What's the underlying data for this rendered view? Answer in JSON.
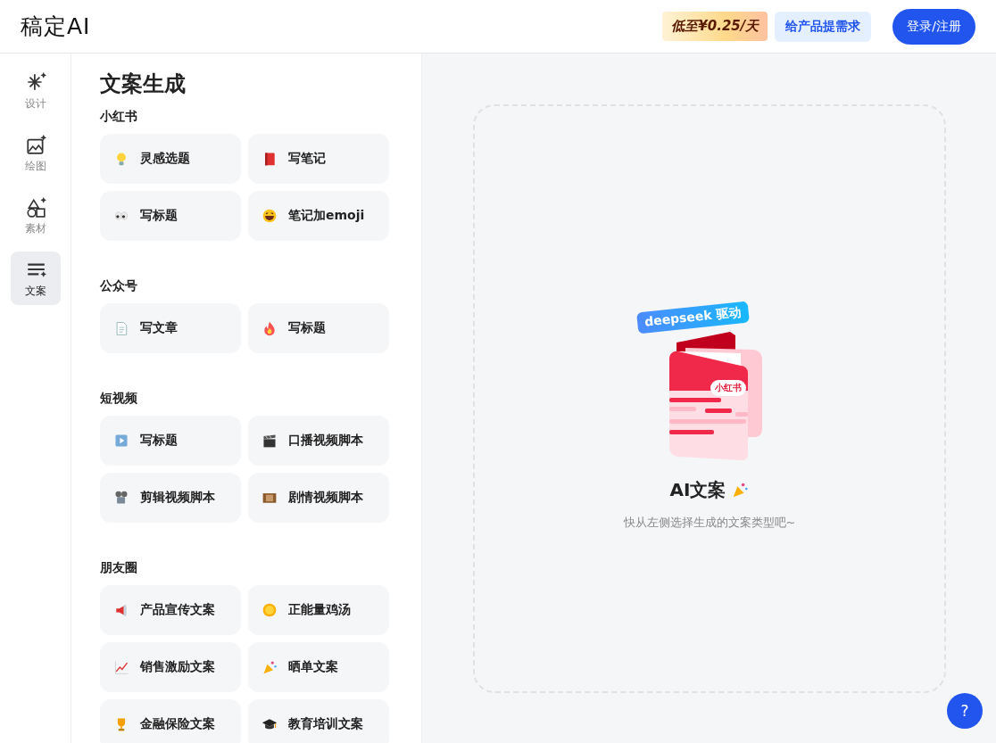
{
  "header": {
    "logo": "稿定AI",
    "promo": "低至¥0.25/天",
    "feedback_button": "给产品提需求",
    "login_button": "登录/注册"
  },
  "sidebar": {
    "items": [
      {
        "label": "设计",
        "kind": "sparkle",
        "selected": false
      },
      {
        "label": "绘图",
        "kind": "image",
        "selected": false
      },
      {
        "label": "素材",
        "kind": "shapes",
        "selected": false
      },
      {
        "label": "文案",
        "kind": "lines",
        "selected": true
      }
    ]
  },
  "panel": {
    "title": "文案生成",
    "sections": [
      {
        "heading": "小红书",
        "tools": [
          {
            "label": "灵感选题",
            "kind": "bulb"
          },
          {
            "label": "写笔记",
            "kind": "book"
          },
          {
            "label": "写标题",
            "kind": "eyes"
          },
          {
            "label": "笔记加emoji",
            "kind": "laugh"
          }
        ]
      },
      {
        "heading": "公众号",
        "tools": [
          {
            "label": "写文章",
            "kind": "page"
          },
          {
            "label": "写标题",
            "kind": "fire"
          }
        ]
      },
      {
        "heading": "短视频",
        "tools": [
          {
            "label": "写标题",
            "kind": "play"
          },
          {
            "label": "口播视频脚本",
            "kind": "clapper"
          },
          {
            "label": "剪辑视频脚本",
            "kind": "projector"
          },
          {
            "label": "剧情视频脚本",
            "kind": "film"
          }
        ]
      },
      {
        "heading": "朋友圈",
        "tools": [
          {
            "label": "产品宣传文案",
            "kind": "megaphone"
          },
          {
            "label": "正能量鸡汤",
            "kind": "sun"
          },
          {
            "label": "销售激励文案",
            "kind": "chart"
          },
          {
            "label": "晒单文案",
            "kind": "party"
          },
          {
            "label": "金融保险文案",
            "kind": "trophy"
          },
          {
            "label": "教育培训文案",
            "kind": "cap"
          }
        ]
      }
    ]
  },
  "preview": {
    "badge": "deepseek 驱动",
    "brand_tag": "小红书",
    "title": "AI文案",
    "hint": "快从左侧选择生成的文案类型吧~"
  },
  "help_button": "?"
}
